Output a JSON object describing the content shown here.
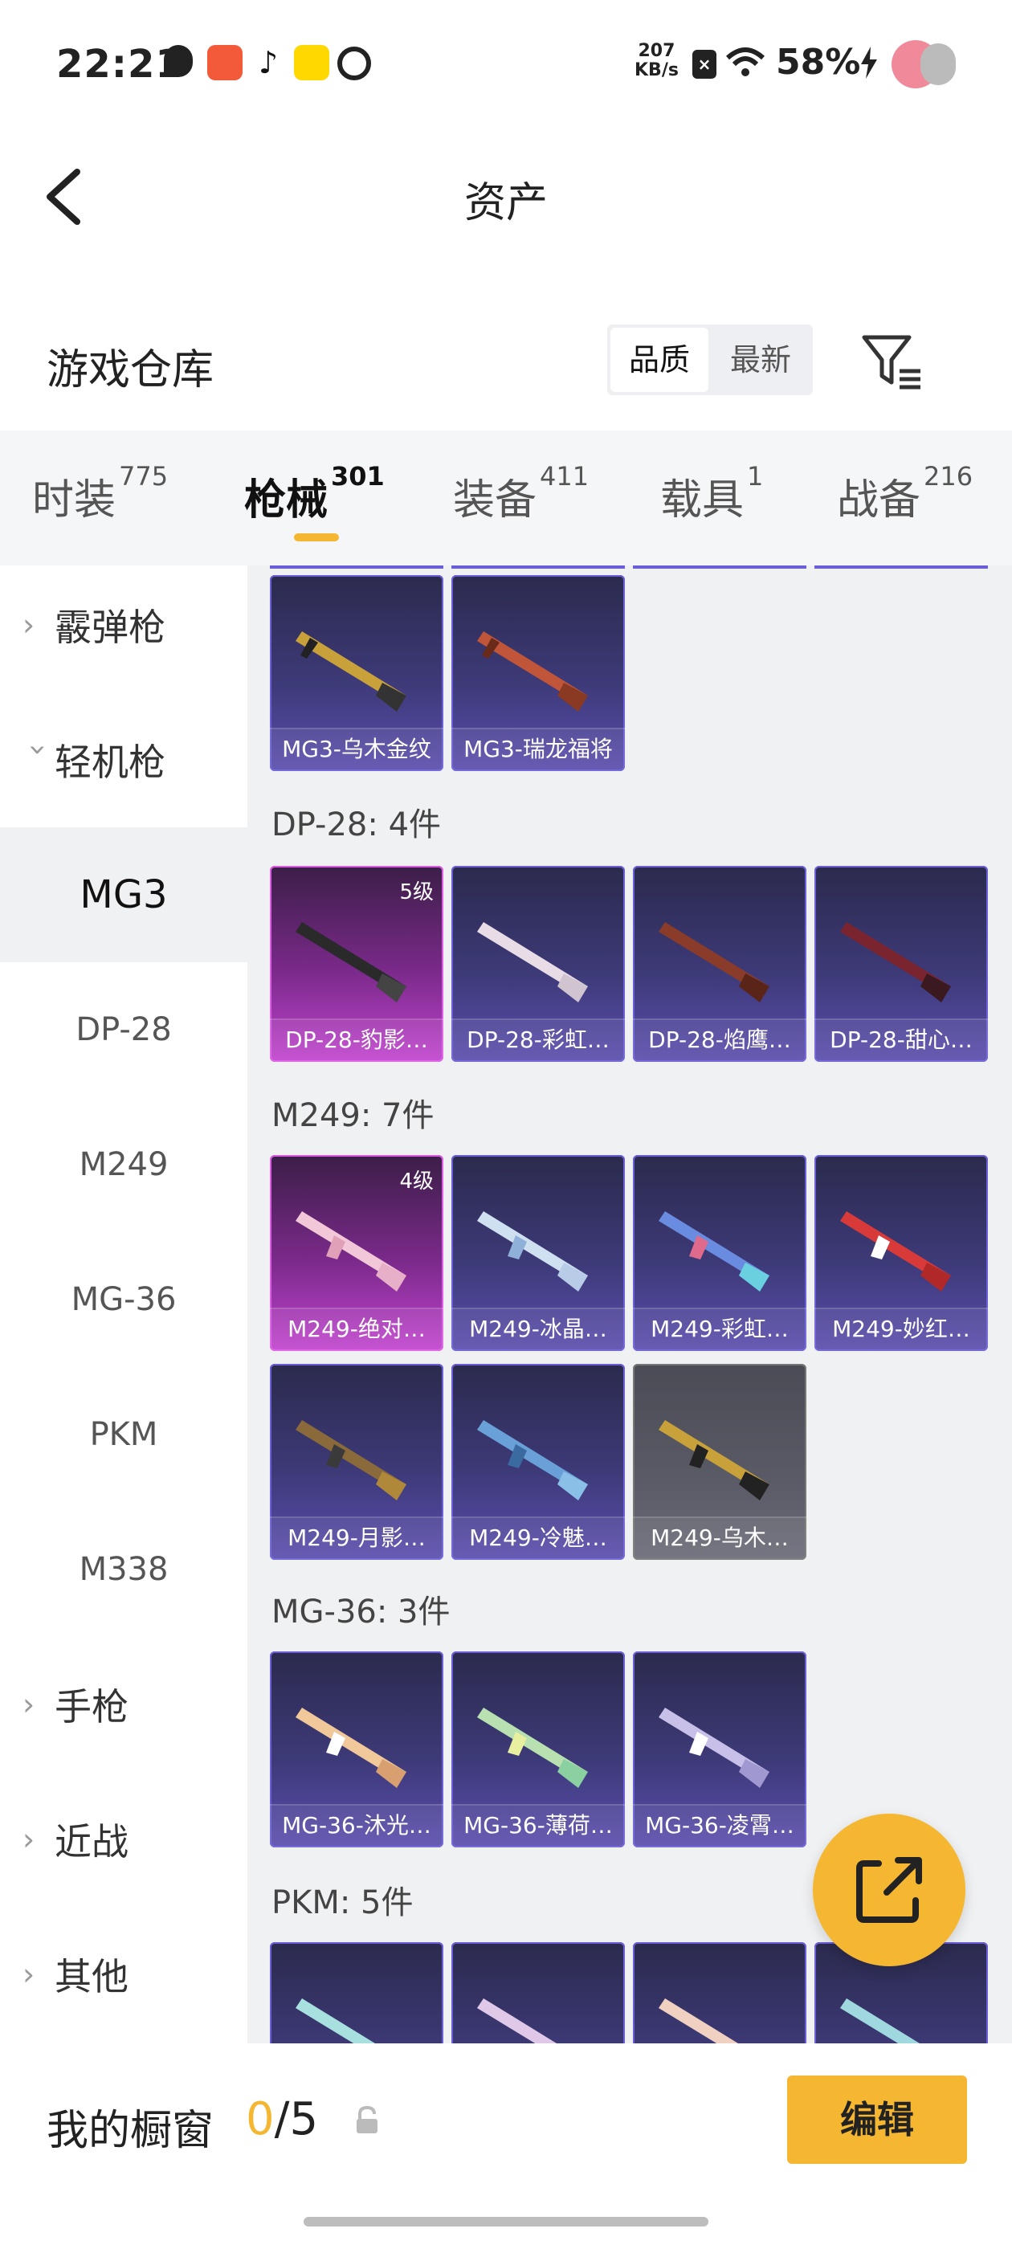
{
  "status_bar": {
    "time": "22:21",
    "net_speed_value": "207",
    "net_speed_unit": "KB/s",
    "battery": "58%",
    "icons": [
      "location-icon",
      "app-icon",
      "tiktok-icon",
      "app-icon",
      "app-icon",
      "sim-icon",
      "wifi-icon",
      "charging-icon"
    ]
  },
  "header": {
    "title": "资产"
  },
  "warehouse": {
    "title": "游戏仓库",
    "sort_options": [
      "品质",
      "最新"
    ],
    "selected_sort": "品质"
  },
  "tabs": [
    {
      "label": "时装",
      "count": "775"
    },
    {
      "label": "枪械",
      "count": "301",
      "active": true
    },
    {
      "label": "装备",
      "count": "411"
    },
    {
      "label": "载具",
      "count": "1"
    },
    {
      "label": "战备",
      "count": "216"
    }
  ],
  "sidebar": {
    "categories": [
      {
        "label": "霰弹枪",
        "expanded": false
      },
      {
        "label": "轻机枪",
        "expanded": true
      },
      {
        "label": "手枪",
        "expanded": false
      },
      {
        "label": "近战",
        "expanded": false
      },
      {
        "label": "其他",
        "expanded": false
      }
    ],
    "subitems": [
      "MG3",
      "DP-28",
      "M249",
      "MG-36",
      "PKM",
      "M338"
    ],
    "selected_subitem": "MG3"
  },
  "content": {
    "mg3_cards": [
      "MG3-乌木金纹",
      "MG3-瑞龙福将"
    ],
    "groups": [
      {
        "label": "DP-28: 4件",
        "cards": [
          {
            "name": "DP-28-豹影…",
            "level": "5级",
            "rarity": "purple"
          },
          {
            "name": "DP-28-彩虹…",
            "rarity": "blue"
          },
          {
            "name": "DP-28-焰鹰…",
            "rarity": "blue"
          },
          {
            "name": "DP-28-甜心…",
            "rarity": "blue"
          }
        ]
      },
      {
        "label": "M249: 7件",
        "cards": [
          {
            "name": "M249-绝对…",
            "level": "4级",
            "rarity": "purple"
          },
          {
            "name": "M249-冰晶…",
            "rarity": "blue"
          },
          {
            "name": "M249-彩虹…",
            "rarity": "blue"
          },
          {
            "name": "M249-妙红…",
            "rarity": "blue"
          },
          {
            "name": "M249-月影…",
            "rarity": "blue"
          },
          {
            "name": "M249-冷魅…",
            "rarity": "blue"
          },
          {
            "name": "M249-乌木…",
            "rarity": "grey"
          }
        ]
      },
      {
        "label": "MG-36: 3件",
        "cards": [
          {
            "name": "MG-36-沐光…",
            "rarity": "blue"
          },
          {
            "name": "MG-36-薄荷…",
            "rarity": "blue"
          },
          {
            "name": "MG-36-凌霄…",
            "rarity": "blue"
          }
        ]
      },
      {
        "label": "PKM: 5件",
        "cards": []
      }
    ]
  },
  "bottom": {
    "showcase_label": "我的橱窗",
    "showcase_current": "0",
    "showcase_total": "/5",
    "edit_label": "编辑"
  },
  "colors": {
    "accent": "#f5b731",
    "card_blue": "#3d3a78",
    "card_purple": "#c245cf",
    "card_grey": "#5a5b66"
  }
}
